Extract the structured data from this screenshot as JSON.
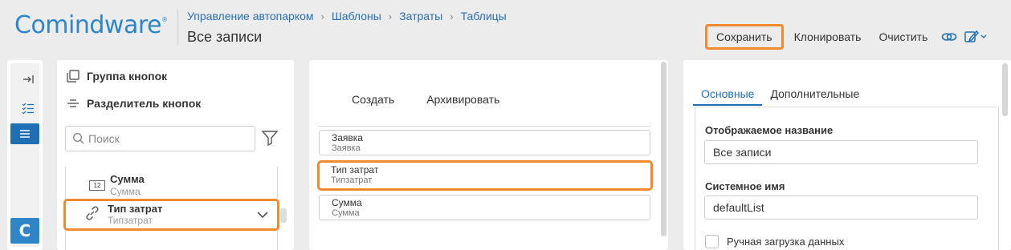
{
  "header": {
    "logo_part1": "Comind",
    "logo_part2": "ware",
    "logo_mark": "®",
    "breadcrumbs": [
      "Управление автопарком",
      "Шаблоны",
      "Затраты",
      "Таблицы"
    ],
    "title": "Все записи"
  },
  "toolbar": {
    "save_label": "Сохранить",
    "clone_label": "Клонировать",
    "clear_label": "Очистить",
    "link_icon": "link-icon",
    "edit_icon": "edit-icon"
  },
  "rail": {
    "logo_letter": "C"
  },
  "palette": {
    "button_group_label": "Группа кнопок",
    "separator_label": "Разделитель кнопок",
    "search_placeholder": "Поиск",
    "clipped_text": "",
    "items": [
      {
        "icon": "12",
        "title": "Сумма",
        "subtitle": "Сумма"
      },
      {
        "title": "Тип затрат",
        "subtitle": "Типзатрат"
      }
    ]
  },
  "canvas": {
    "buttons": [
      "Создать",
      "Архивировать"
    ],
    "fields": [
      {
        "title": "Заявка",
        "subtitle": "Заявка"
      },
      {
        "title": "Тип затрат",
        "subtitle": "Типзатрат"
      },
      {
        "title": "Сумма",
        "subtitle": "Сумма"
      }
    ]
  },
  "properties": {
    "tabs": [
      "Основные",
      "Дополнительные"
    ],
    "display_name_label": "Отображаемое название",
    "display_name_value": "Все записи",
    "system_name_label": "Системное имя",
    "system_name_value": "defaultList",
    "checkbox_label": "Ручная загрузка данных"
  },
  "colors": {
    "accent": "#1f6fb5",
    "highlight": "#f08a2c",
    "brand": "#2e86c9"
  }
}
